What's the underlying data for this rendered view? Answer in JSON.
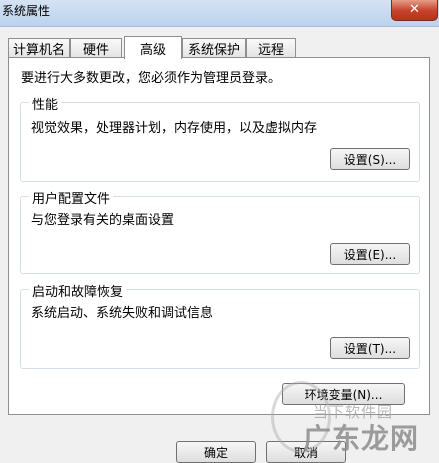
{
  "window": {
    "title": "系统属性",
    "close_glyph": "✕"
  },
  "tabs": [
    {
      "label": "计算机名"
    },
    {
      "label": "硬件"
    },
    {
      "label": "高级",
      "active": true
    },
    {
      "label": "系统保护"
    },
    {
      "label": "远程"
    }
  ],
  "intro": "要进行大多数更改，您必须作为管理员登录。",
  "groups": {
    "performance": {
      "title": "性能",
      "description": "视觉效果，处理器计划，内存使用，以及虚拟内存",
      "button": "设置(S)..."
    },
    "user_profiles": {
      "title": "用户配置文件",
      "description": "与您登录有关的桌面设置",
      "button": "设置(E)..."
    },
    "startup_recovery": {
      "title": "启动和故障恢复",
      "description": "系统启动、系统失败和调试信息",
      "button": "设置(T)..."
    }
  },
  "env_button": "环境变量(N)...",
  "footer": {
    "ok": "确定",
    "cancel": "取消"
  },
  "watermark": {
    "title": "当下软件园",
    "brand": "广东龙网"
  }
}
